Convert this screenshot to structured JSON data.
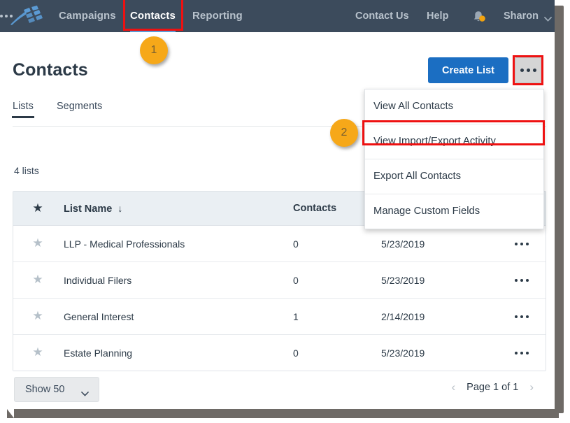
{
  "topnav": {
    "logo_name": "constant-contact-flag-logo",
    "items": [
      {
        "label": "Campaigns",
        "name": "nav-item-campaigns",
        "active": false
      },
      {
        "label": "Contacts",
        "name": "nav-item-contacts",
        "active": true
      },
      {
        "label": "Reporting",
        "name": "nav-item-reporting",
        "active": false
      }
    ],
    "more_label": "more-menu-icon",
    "contact_us": "Contact Us",
    "help": "Help",
    "bell_icon": "notification-bell-icon",
    "user_name": "Sharon",
    "user_caret": "chevron-down-icon",
    "bg_color": "#3c4b5c",
    "active_underline_color": "#5b9bd5"
  },
  "page": {
    "title": "Contacts",
    "tabs": [
      {
        "label": "Lists",
        "active": true
      },
      {
        "label": "Segments",
        "active": false
      }
    ],
    "create_list_label": "Create List",
    "create_list_color": "#1b6ec2",
    "kebab_label": "more-options-icon",
    "list_count": "4 lists"
  },
  "menu": {
    "items": [
      {
        "label": "View All Contacts"
      },
      {
        "label": "View Import/Export Activity"
      },
      {
        "label": "Export All Contacts"
      },
      {
        "label": "Manage Custom Fields"
      }
    ]
  },
  "table": {
    "columns": {
      "star": "★",
      "list_name": "List Name",
      "sort_arrow": "↓",
      "contacts": "Contacts"
    },
    "rows": [
      {
        "star": "★",
        "name": "LLP - Medical Professionals",
        "contacts": "0",
        "date": "5/23/2019",
        "menu": "row-more-icon"
      },
      {
        "star": "★",
        "name": "Individual Filers",
        "contacts": "0",
        "date": "5/23/2019",
        "menu": "row-more-icon"
      },
      {
        "star": "★",
        "name": "General Interest",
        "contacts": "1",
        "date": "2/14/2019",
        "menu": "row-more-icon"
      },
      {
        "star": "★",
        "name": "Estate Planning",
        "contacts": "0",
        "date": "5/23/2019",
        "menu": "row-more-icon"
      }
    ]
  },
  "footer": {
    "show_label": "Show 50",
    "show_caret": "chevron-down-icon",
    "prev_arrow": "‹",
    "page_text": "Page 1 of 1",
    "next_arrow": "›"
  },
  "annotations": {
    "badge_1": "1",
    "badge_2": "2",
    "highlight_color": "#ee1111",
    "badge_color": "#f6a819"
  }
}
